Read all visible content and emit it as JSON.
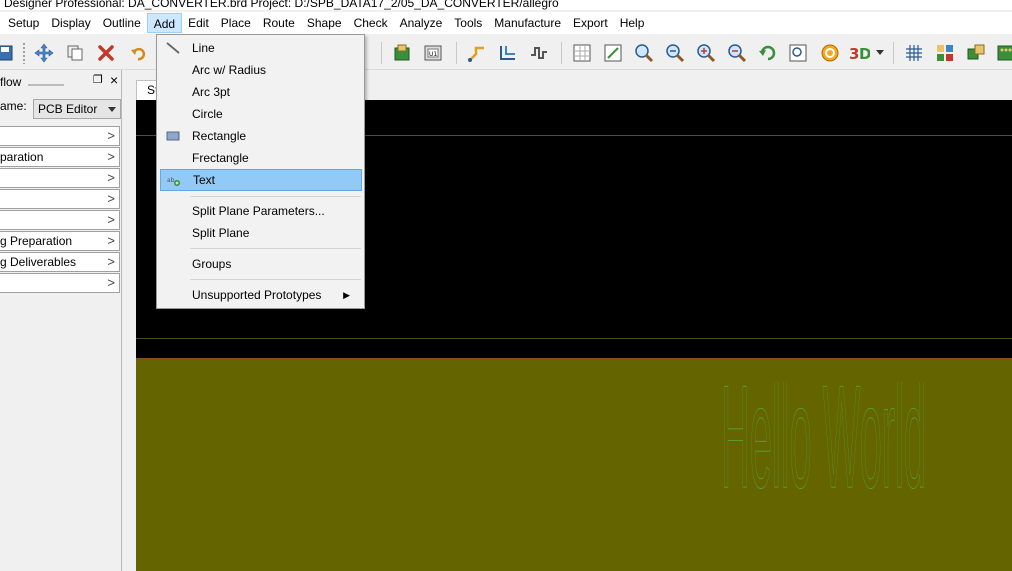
{
  "window": {
    "title": "Designer Professional: DA_CONVERTER.brd  Project: D:/SPB_DATA17_2/05_DA_CONVERTER/allegro"
  },
  "menubar": {
    "items": [
      {
        "label": "Setup"
      },
      {
        "label": "Display"
      },
      {
        "label": "Outline"
      },
      {
        "label": "Add"
      },
      {
        "label": "Edit"
      },
      {
        "label": "Place"
      },
      {
        "label": "Route"
      },
      {
        "label": "Shape"
      },
      {
        "label": "Check"
      },
      {
        "label": "Analyze"
      },
      {
        "label": "Tools"
      },
      {
        "label": "Manufacture"
      },
      {
        "label": "Export"
      },
      {
        "label": "Help"
      }
    ],
    "active": "Add"
  },
  "add_menu": {
    "items": [
      {
        "label": "Line",
        "icon": "line-icon"
      },
      {
        "label": "Arc w/ Radius"
      },
      {
        "label": "Arc 3pt"
      },
      {
        "label": "Circle"
      },
      {
        "label": "Rectangle",
        "icon": "rectangle-icon"
      },
      {
        "label": "Frectangle"
      },
      {
        "label": "Text",
        "icon": "text-icon",
        "highlighted": true
      },
      {
        "label": "Split Plane Parameters..."
      },
      {
        "label": "Split Plane"
      },
      {
        "label": "Groups"
      },
      {
        "label": "Unsupported Prototypes",
        "submenu": true
      }
    ]
  },
  "workflow_panel": {
    "title": "flow",
    "name_label": "ame:",
    "workflow_name": "PCB Editor",
    "items": [
      {
        "label": ""
      },
      {
        "label": "paration"
      },
      {
        "label": ""
      },
      {
        "label": ""
      },
      {
        "label": ""
      },
      {
        "label": "g Preparation"
      },
      {
        "label": "g Deliverables"
      },
      {
        "label": ""
      }
    ]
  },
  "canvas": {
    "tab_label": "St",
    "board_text": "Hello World",
    "colors": {
      "background": "#000000",
      "board": "#656500",
      "text": "#4caf50"
    }
  },
  "toolbar": {
    "icons": [
      "save-icon",
      "move-icon",
      "copy-icon",
      "delete-icon",
      "undo-icon",
      "component-icon",
      "u1-icon",
      "route-icon",
      "slide-icon",
      "delay-tune-icon",
      "grid-icon",
      "zoom-fit-icon",
      "zoom-in-icon",
      "zoom-out-icon",
      "zoom-previous-icon",
      "zoom-world-icon",
      "refresh-icon",
      "3d-icon",
      "grid-toggle-icon",
      "color-icon",
      "shadow-icon"
    ]
  }
}
